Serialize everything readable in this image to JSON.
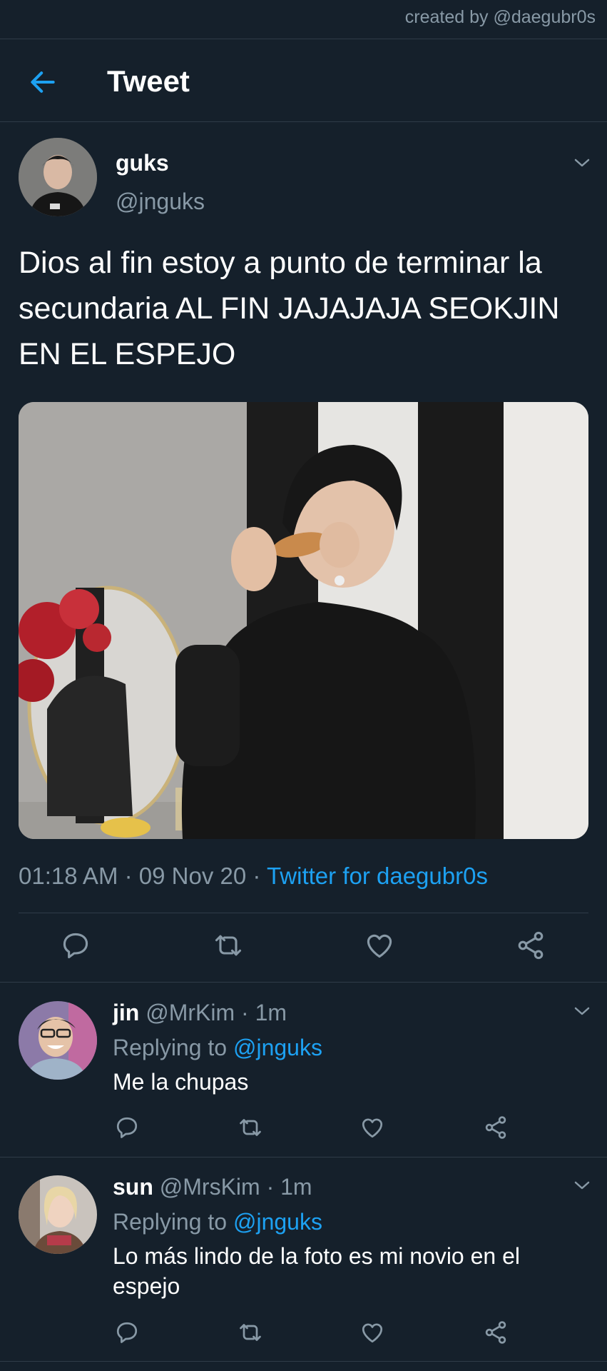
{
  "credit": "created by @daegubr0s",
  "header": {
    "title": "Tweet",
    "back_icon": "arrow-left-icon"
  },
  "tweet": {
    "name": "guks",
    "handle": "@jnguks",
    "text": "Dios al fin estoy a punto de terminar la secundaria AL FIN JAJAJAJA SEOKJIN EN EL ESPEJO",
    "time": "01:18 AM",
    "date": "09 Nov 20",
    "separator": "·",
    "source": "Twitter for daegubr0s",
    "actions": [
      "reply-icon",
      "retweet-icon",
      "like-icon",
      "share-icon"
    ]
  },
  "replies": [
    {
      "name": "jin",
      "handle": "@MrKim",
      "age": "1m",
      "replying_label": "Replying to",
      "mention": "@jnguks",
      "text": "Me la chupas"
    },
    {
      "name": "sun",
      "handle": "@MrsKim",
      "age": "1m",
      "replying_label": "Replying to",
      "mention": "@jnguks",
      "text": "Lo más lindo de la foto es mi novio en el espejo"
    }
  ],
  "colors": {
    "background": "#15202b",
    "accent": "#1da1f2",
    "secondary_text": "#8899a6",
    "divider": "#2f3c48"
  }
}
